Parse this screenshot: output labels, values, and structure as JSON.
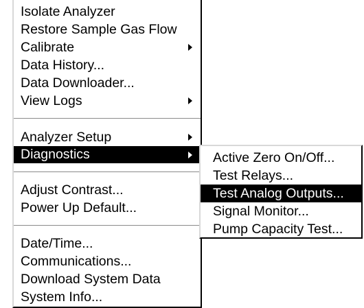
{
  "main_menu": {
    "group1": [
      {
        "label": "Isolate Analyzer",
        "submenu": false
      },
      {
        "label": "Restore Sample Gas Flow",
        "submenu": false
      },
      {
        "label": "Calibrate",
        "submenu": true
      },
      {
        "label": "Data History...",
        "submenu": false
      },
      {
        "label": "Data Downloader...",
        "submenu": false
      },
      {
        "label": "View Logs",
        "submenu": true
      }
    ],
    "group2": [
      {
        "label": "Analyzer Setup",
        "submenu": true
      },
      {
        "label": "Diagnostics",
        "submenu": true,
        "highlighted": true
      }
    ],
    "group3": [
      {
        "label": "Adjust Contrast...",
        "submenu": false
      },
      {
        "label": "Power Up Default...",
        "submenu": false
      }
    ],
    "group4": [
      {
        "label": "Date/Time...",
        "submenu": false
      },
      {
        "label": "Communications...",
        "submenu": false
      },
      {
        "label": "Download System Data",
        "submenu": false
      },
      {
        "label": "System Info...",
        "submenu": false
      }
    ]
  },
  "diagnostics_submenu": {
    "items": [
      {
        "label": "Active Zero On/Off..."
      },
      {
        "label": "Test Relays..."
      },
      {
        "label": "Test Analog Outputs...",
        "highlighted": true
      },
      {
        "label": "Signal Monitor..."
      },
      {
        "label": "Pump Capacity Test..."
      }
    ]
  },
  "colors": {
    "highlight_bg": "#000000",
    "highlight_fg": "#ffffff",
    "menu_bg": "#ffffff"
  }
}
